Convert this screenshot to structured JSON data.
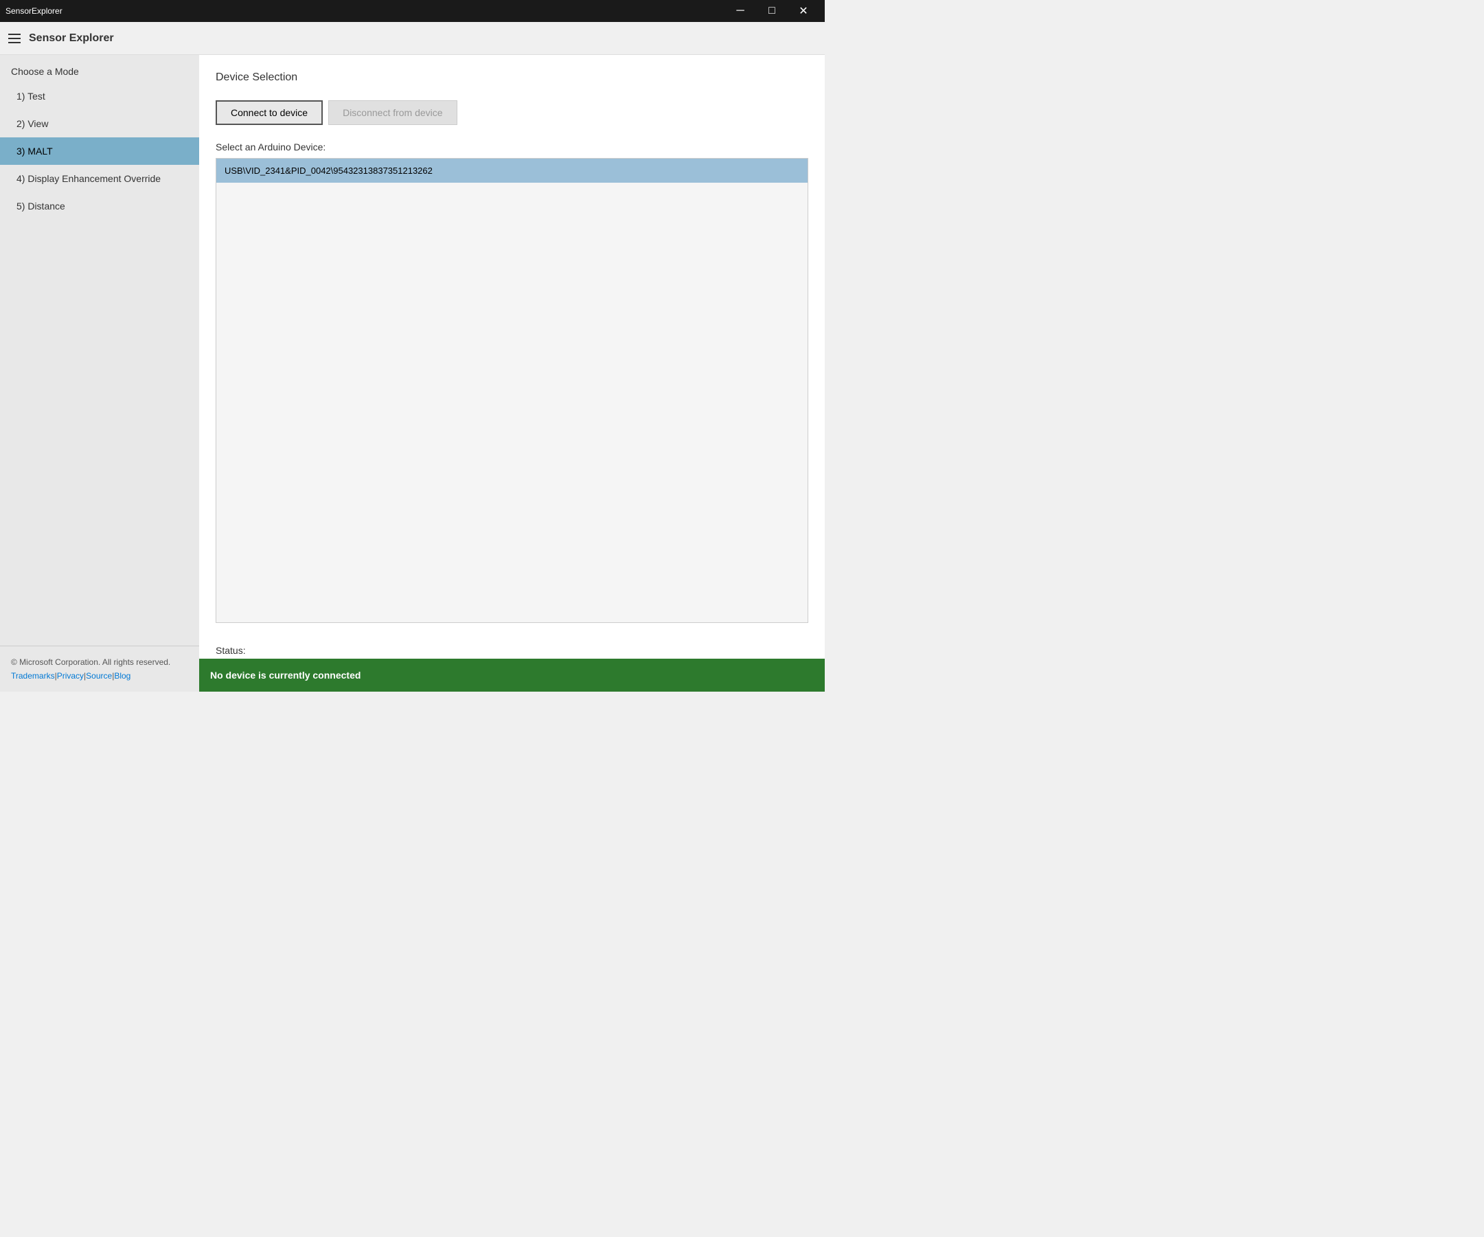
{
  "titleBar": {
    "title": "SensorExplorer",
    "minimizeLabel": "─",
    "maximizeLabel": "□",
    "closeLabel": "✕"
  },
  "appHeader": {
    "title": "Sensor Explorer"
  },
  "sidebar": {
    "heading": "Choose a Mode",
    "items": [
      {
        "id": "test",
        "label": "1) Test",
        "active": false
      },
      {
        "id": "view",
        "label": "2) View",
        "active": false
      },
      {
        "id": "malt",
        "label": "3) MALT",
        "active": true
      },
      {
        "id": "display-enhancement-override",
        "label": "4) Display Enhancement Override",
        "active": false
      },
      {
        "id": "distance",
        "label": "5) Distance",
        "active": false
      }
    ],
    "footer": {
      "copyright": "© Microsoft Corporation. All rights reserved.",
      "links": [
        "Trademarks",
        "Privacy",
        "Source",
        "Blog"
      ]
    }
  },
  "content": {
    "sectionTitle": "Device Selection",
    "connectButton": "Connect to device",
    "disconnectButton": "Disconnect from device",
    "deviceListLabel": "Select an Arduino Device:",
    "devices": [
      {
        "id": "device-1",
        "label": "USB\\VID_2341&PID_0042\\95432313837351213262",
        "selected": true
      }
    ],
    "statusLabel": "Status:",
    "statusMessage": "No device is currently connected"
  }
}
